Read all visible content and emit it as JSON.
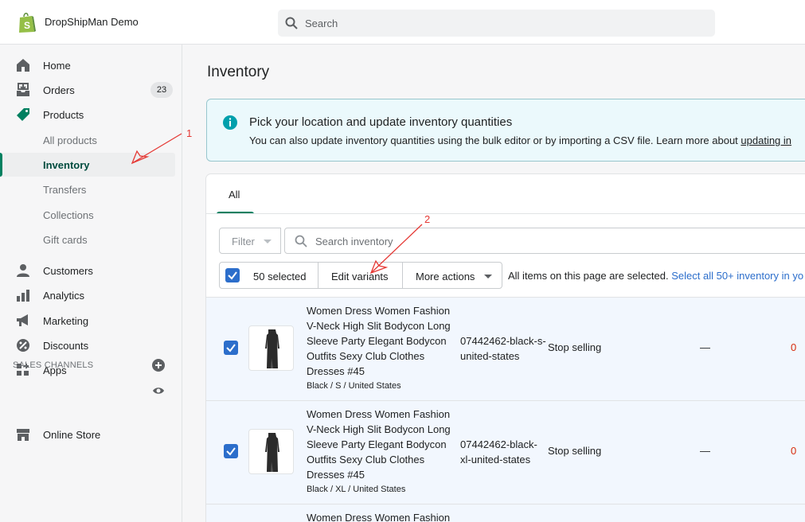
{
  "store": {
    "name": "DropShipMan Demo"
  },
  "search": {
    "placeholder": "Search"
  },
  "sidebar": {
    "items": [
      {
        "label": "Home",
        "icon": "home-icon"
      },
      {
        "label": "Orders",
        "icon": "orders-icon",
        "badge": "23"
      },
      {
        "label": "Products",
        "icon": "tag-icon"
      }
    ],
    "products_sub": [
      {
        "label": "All products"
      },
      {
        "label": "Inventory",
        "active": true
      },
      {
        "label": "Transfers"
      },
      {
        "label": "Collections"
      },
      {
        "label": "Gift cards"
      }
    ],
    "items2": [
      {
        "label": "Customers",
        "icon": "person-icon"
      },
      {
        "label": "Analytics",
        "icon": "bar-chart-icon"
      },
      {
        "label": "Marketing",
        "icon": "megaphone-icon"
      },
      {
        "label": "Discounts",
        "icon": "discount-icon"
      },
      {
        "label": "Apps",
        "icon": "apps-icon"
      }
    ],
    "sales_channels_heading": "SALES CHANNELS",
    "online_store": "Online Store"
  },
  "page": {
    "title": "Inventory",
    "banner": {
      "title": "Pick your location and update inventory quantities",
      "body": "You can also update inventory quantities using the bulk editor or by importing a CSV file. Learn more about ",
      "link": "updating in"
    },
    "tabs": [
      {
        "label": "All"
      }
    ],
    "filter_label": "Filter",
    "search_placeholder": "Search inventory",
    "bulk": {
      "selected": "50 selected",
      "edit_variants": "Edit variants",
      "more_actions": "More actions",
      "message": "All items on this page are selected.",
      "select_all": "Select all 50+ inventory in yo"
    },
    "rows": [
      {
        "name": "Women Dress Women Fashion V-Neck High Slit Bodycon Long Sleeve Party Elegant Bodycon Outfits Sexy Club Clothes Dresses #45",
        "variant": "Black / S / United States",
        "sku": "07442462-black-s-united-states",
        "policy": "Stop selling",
        "committed": "—",
        "available": "0"
      },
      {
        "name": "Women Dress Women Fashion V-Neck High Slit Bodycon Long Sleeve Party Elegant Bodycon Outfits Sexy Club Clothes Dresses #45",
        "variant": "Black / XL / United States",
        "sku": "07442462-black-xl-united-states",
        "policy": "Stop selling",
        "committed": "—",
        "available": "0"
      },
      {
        "name": "Women Dress Women Fashion"
      }
    ]
  },
  "annotations": {
    "arrow1": "1",
    "arrow2": "2"
  }
}
